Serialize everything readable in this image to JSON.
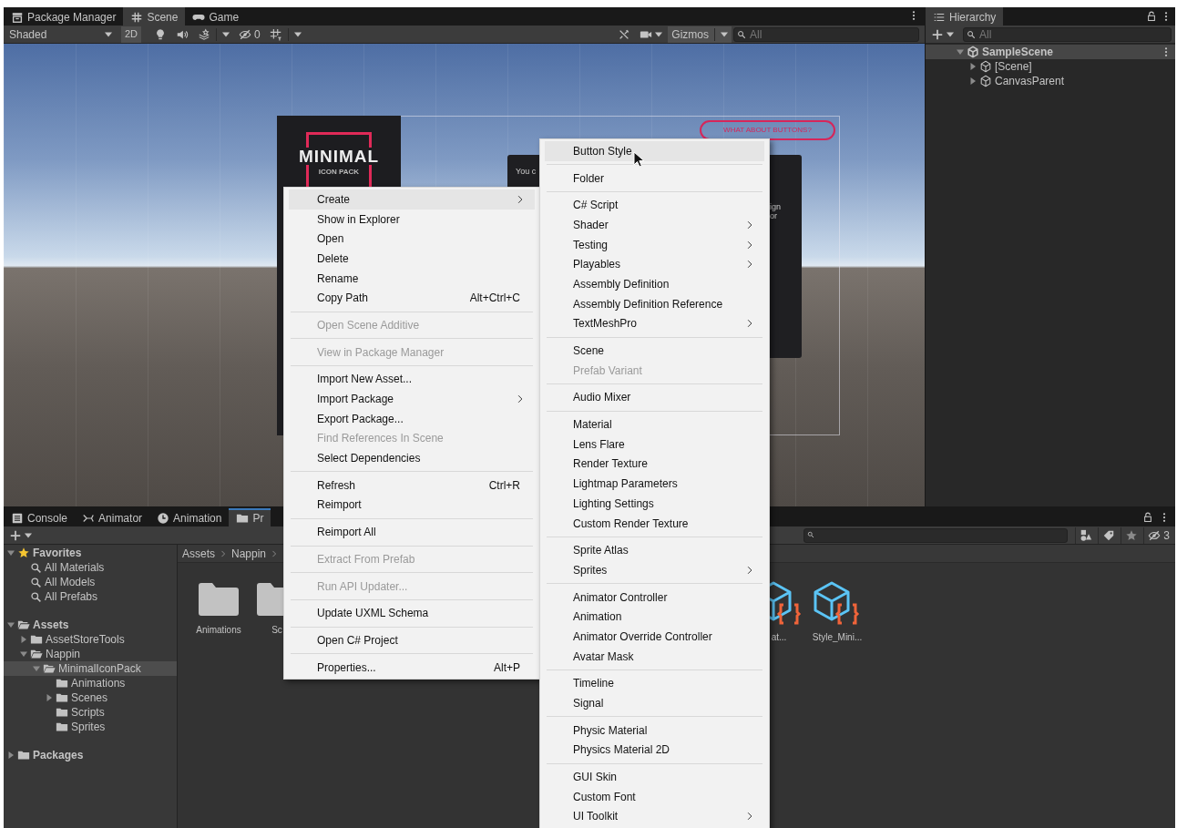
{
  "scene_view": {
    "tabs": [
      {
        "label": "Package Manager",
        "selected": false
      },
      {
        "label": "Scene",
        "selected": true
      },
      {
        "label": "Game",
        "selected": false
      }
    ],
    "toolbar": {
      "draw_mode": "Shaded",
      "mode_2d": "2D",
      "hidden_count": "0",
      "gizmos": "Gizmos",
      "search_placeholder": "All"
    },
    "scene_content": {
      "logo_title": "MINIMAL",
      "logo_subtitle": "ICON PACK",
      "panel_text": "You c",
      "side_text": [
        "ign",
        "or"
      ],
      "button_text": "WHAT ABOUT BUTTONS?"
    }
  },
  "hierarchy": {
    "title": "Hierarchy",
    "search_placeholder": "All",
    "tree": [
      {
        "label": "SampleScene",
        "kind": "scene",
        "expanded": true,
        "children": [
          {
            "label": "[Scene]",
            "kind": "object",
            "expanded": false
          },
          {
            "label": "CanvasParent",
            "kind": "object",
            "expanded": false
          }
        ]
      }
    ]
  },
  "project": {
    "tabs": [
      {
        "label": "Console",
        "selected": false
      },
      {
        "label": "Animator",
        "selected": false
      },
      {
        "label": "Animation",
        "selected": false
      },
      {
        "label": "Pr",
        "selected": true
      }
    ],
    "hidden_count": "3",
    "tree": [
      {
        "label": "Favorites",
        "kind": "favorites",
        "expanded": true,
        "selected": false,
        "children": [
          {
            "label": "All Materials",
            "kind": "search",
            "selected": false
          },
          {
            "label": "All Models",
            "kind": "search",
            "selected": false
          },
          {
            "label": "All Prefabs",
            "kind": "search",
            "selected": false
          }
        ]
      },
      {
        "label": "Assets",
        "kind": "folder",
        "expanded": true,
        "selected": false,
        "children": [
          {
            "label": "AssetStoreTools",
            "kind": "folder",
            "expanded": false,
            "selected": false
          },
          {
            "label": "Nappin",
            "kind": "folder",
            "expanded": true,
            "selected": false,
            "children": [
              {
                "label": "MinimalIconPack",
                "kind": "folder",
                "expanded": true,
                "selected": true,
                "children": [
                  {
                    "label": "Animations",
                    "kind": "folder",
                    "selected": false
                  },
                  {
                    "label": "Scenes",
                    "kind": "folder",
                    "expanded": false,
                    "selected": false
                  },
                  {
                    "label": "Scripts",
                    "kind": "folder",
                    "selected": false
                  },
                  {
                    "label": "Sprites",
                    "kind": "folder",
                    "selected": false
                  }
                ]
              }
            ]
          }
        ]
      },
      {
        "label": "Packages",
        "kind": "folder",
        "expanded": false,
        "selected": false
      }
    ],
    "breadcrumb": [
      "Assets",
      "Nappin"
    ],
    "assets": [
      {
        "label": "Animations",
        "kind": "folder"
      },
      {
        "label": "Sc",
        "kind": "folder"
      },
      {
        "label": "at...",
        "kind": "script"
      },
      {
        "label": "Style_Mini...",
        "kind": "script"
      }
    ]
  },
  "context_menu": {
    "items": [
      {
        "kind": "item",
        "label": "Create",
        "submenu": true,
        "disabled": false,
        "highlighted": true
      },
      {
        "kind": "item",
        "label": "Show in Explorer",
        "submenu": false,
        "disabled": false,
        "highlighted": false
      },
      {
        "kind": "item",
        "label": "Open",
        "submenu": false,
        "disabled": false,
        "highlighted": false
      },
      {
        "kind": "item",
        "label": "Delete",
        "submenu": false,
        "disabled": false,
        "highlighted": false
      },
      {
        "kind": "item",
        "label": "Rename",
        "submenu": false,
        "disabled": false,
        "highlighted": false
      },
      {
        "kind": "item",
        "label": "Copy Path",
        "shortcut": "Alt+Ctrl+C",
        "submenu": false,
        "disabled": false,
        "highlighted": false
      },
      {
        "kind": "separator"
      },
      {
        "kind": "item",
        "label": "Open Scene Additive",
        "submenu": false,
        "disabled": true,
        "highlighted": false
      },
      {
        "kind": "separator"
      },
      {
        "kind": "item",
        "label": "View in Package Manager",
        "submenu": false,
        "disabled": true,
        "highlighted": false
      },
      {
        "kind": "separator"
      },
      {
        "kind": "item",
        "label": "Import New Asset...",
        "submenu": false,
        "disabled": false,
        "highlighted": false
      },
      {
        "kind": "item",
        "label": "Import Package",
        "submenu": true,
        "disabled": false,
        "highlighted": false
      },
      {
        "kind": "item",
        "label": "Export Package...",
        "submenu": false,
        "disabled": false,
        "highlighted": false
      },
      {
        "kind": "item",
        "label": "Find References In Scene",
        "submenu": false,
        "disabled": true,
        "highlighted": false
      },
      {
        "kind": "item",
        "label": "Select Dependencies",
        "submenu": false,
        "disabled": false,
        "highlighted": false
      },
      {
        "kind": "separator"
      },
      {
        "kind": "item",
        "label": "Refresh",
        "shortcut": "Ctrl+R",
        "submenu": false,
        "disabled": false,
        "highlighted": false
      },
      {
        "kind": "item",
        "label": "Reimport",
        "submenu": false,
        "disabled": false,
        "highlighted": false
      },
      {
        "kind": "separator"
      },
      {
        "kind": "item",
        "label": "Reimport All",
        "submenu": false,
        "disabled": false,
        "highlighted": false
      },
      {
        "kind": "separator"
      },
      {
        "kind": "item",
        "label": "Extract From Prefab",
        "submenu": false,
        "disabled": true,
        "highlighted": false
      },
      {
        "kind": "separator"
      },
      {
        "kind": "item",
        "label": "Run API Updater...",
        "submenu": false,
        "disabled": true,
        "highlighted": false
      },
      {
        "kind": "separator"
      },
      {
        "kind": "item",
        "label": "Update UXML Schema",
        "submenu": false,
        "disabled": false,
        "highlighted": false
      },
      {
        "kind": "separator"
      },
      {
        "kind": "item",
        "label": "Open C# Project",
        "submenu": false,
        "disabled": false,
        "highlighted": false
      },
      {
        "kind": "separator"
      },
      {
        "kind": "item",
        "label": "Properties...",
        "shortcut": "Alt+P",
        "submenu": false,
        "disabled": false,
        "highlighted": false
      }
    ]
  },
  "create_submenu": {
    "items": [
      {
        "kind": "item",
        "label": "Button Style",
        "submenu": false,
        "disabled": false,
        "highlighted": true
      },
      {
        "kind": "separator"
      },
      {
        "kind": "item",
        "label": "Folder",
        "submenu": false,
        "disabled": false,
        "highlighted": false
      },
      {
        "kind": "separator"
      },
      {
        "kind": "item",
        "label": "C# Script",
        "submenu": false,
        "disabled": false,
        "highlighted": false
      },
      {
        "kind": "item",
        "label": "Shader",
        "submenu": true,
        "disabled": false,
        "highlighted": false
      },
      {
        "kind": "item",
        "label": "Testing",
        "submenu": true,
        "disabled": false,
        "highlighted": false
      },
      {
        "kind": "item",
        "label": "Playables",
        "submenu": true,
        "disabled": false,
        "highlighted": false
      },
      {
        "kind": "item",
        "label": "Assembly Definition",
        "submenu": false,
        "disabled": false,
        "highlighted": false
      },
      {
        "kind": "item",
        "label": "Assembly Definition Reference",
        "submenu": false,
        "disabled": false,
        "highlighted": false
      },
      {
        "kind": "item",
        "label": "TextMeshPro",
        "submenu": true,
        "disabled": false,
        "highlighted": false
      },
      {
        "kind": "separator"
      },
      {
        "kind": "item",
        "label": "Scene",
        "submenu": false,
        "disabled": false,
        "highlighted": false
      },
      {
        "kind": "item",
        "label": "Prefab Variant",
        "submenu": false,
        "disabled": true,
        "highlighted": false
      },
      {
        "kind": "separator"
      },
      {
        "kind": "item",
        "label": "Audio Mixer",
        "submenu": false,
        "disabled": false,
        "highlighted": false
      },
      {
        "kind": "separator"
      },
      {
        "kind": "item",
        "label": "Material",
        "submenu": false,
        "disabled": false,
        "highlighted": false
      },
      {
        "kind": "item",
        "label": "Lens Flare",
        "submenu": false,
        "disabled": false,
        "highlighted": false
      },
      {
        "kind": "item",
        "label": "Render Texture",
        "submenu": false,
        "disabled": false,
        "highlighted": false
      },
      {
        "kind": "item",
        "label": "Lightmap Parameters",
        "submenu": false,
        "disabled": false,
        "highlighted": false
      },
      {
        "kind": "item",
        "label": "Lighting Settings",
        "submenu": false,
        "disabled": false,
        "highlighted": false
      },
      {
        "kind": "item",
        "label": "Custom Render Texture",
        "submenu": false,
        "disabled": false,
        "highlighted": false
      },
      {
        "kind": "separator"
      },
      {
        "kind": "item",
        "label": "Sprite Atlas",
        "submenu": false,
        "disabled": false,
        "highlighted": false
      },
      {
        "kind": "item",
        "label": "Sprites",
        "submenu": true,
        "disabled": false,
        "highlighted": false
      },
      {
        "kind": "separator"
      },
      {
        "kind": "item",
        "label": "Animator Controller",
        "submenu": false,
        "disabled": false,
        "highlighted": false
      },
      {
        "kind": "item",
        "label": "Animation",
        "submenu": false,
        "disabled": false,
        "highlighted": false
      },
      {
        "kind": "item",
        "label": "Animator Override Controller",
        "submenu": false,
        "disabled": false,
        "highlighted": false
      },
      {
        "kind": "item",
        "label": "Avatar Mask",
        "submenu": false,
        "disabled": false,
        "highlighted": false
      },
      {
        "kind": "separator"
      },
      {
        "kind": "item",
        "label": "Timeline",
        "submenu": false,
        "disabled": false,
        "highlighted": false
      },
      {
        "kind": "item",
        "label": "Signal",
        "submenu": false,
        "disabled": false,
        "highlighted": false
      },
      {
        "kind": "separator"
      },
      {
        "kind": "item",
        "label": "Physic Material",
        "submenu": false,
        "disabled": false,
        "highlighted": false
      },
      {
        "kind": "item",
        "label": "Physics Material 2D",
        "submenu": false,
        "disabled": false,
        "highlighted": false
      },
      {
        "kind": "separator"
      },
      {
        "kind": "item",
        "label": "GUI Skin",
        "submenu": false,
        "disabled": false,
        "highlighted": false
      },
      {
        "kind": "item",
        "label": "Custom Font",
        "submenu": false,
        "disabled": false,
        "highlighted": false
      },
      {
        "kind": "item",
        "label": "UI Toolkit",
        "submenu": true,
        "disabled": false,
        "highlighted": false
      }
    ]
  }
}
